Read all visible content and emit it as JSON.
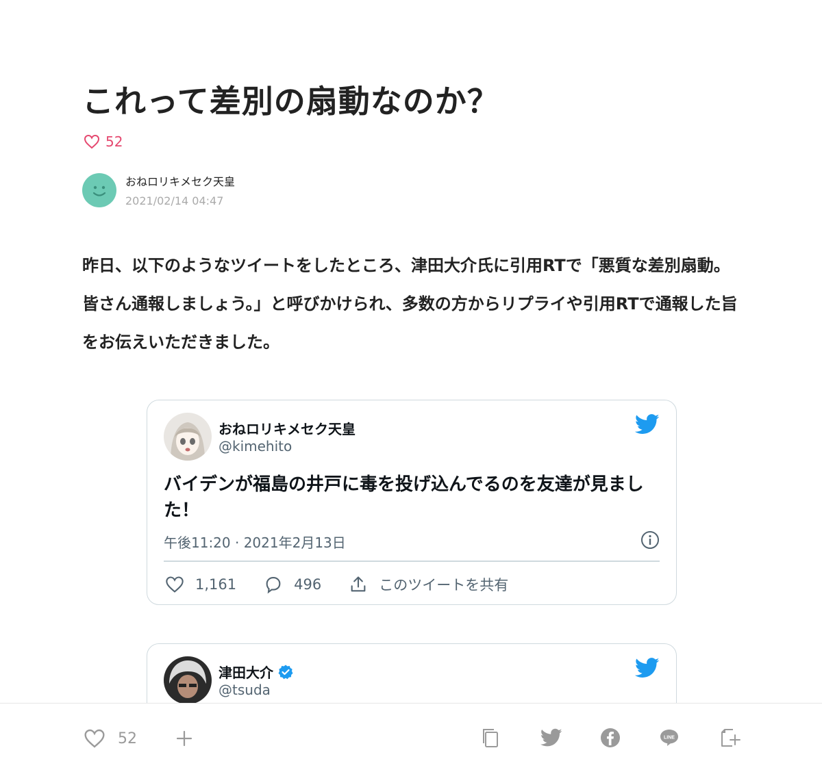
{
  "article": {
    "title": "これって差別の扇動なのか？",
    "like_count": "52",
    "author_name": "おねロリキメセク天皇",
    "date": "2021/02/14 04:47",
    "body": "昨日、以下のようなツイートをしたところ、津田大介氏に引用RTで「悪質な差別扇動。皆さん通報しましょう。」と呼びかけられ、多数の方からリプライや引用RTで通報した旨をお伝えいただきました。"
  },
  "tweets": [
    {
      "name": "おねロリキメセク天皇",
      "handle": "@kimehito",
      "text": "バイデンが福島の井戸に毒を投げ込んでるのを友達が見ました！",
      "time": "午後11:20 · 2021年2月13日",
      "likes": "1,161",
      "replies": "496",
      "share": "このツイートを共有"
    },
    {
      "name": "津田大介",
      "handle": "@tsuda",
      "verified": true
    }
  ],
  "bottom_bar": {
    "like_count": "52",
    "icons": [
      "heart-icon",
      "plus-icon",
      "copy-icon",
      "twitter-icon",
      "facebook-icon",
      "line-icon",
      "save-icon"
    ]
  },
  "colors": {
    "like_accent": "#e5486f",
    "avatar_bg": "#6ccab4",
    "twitter_blue": "#1d9bf0",
    "muted": "#536471"
  }
}
